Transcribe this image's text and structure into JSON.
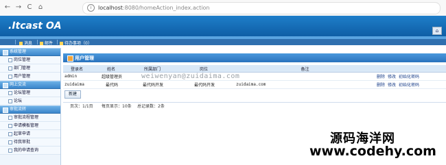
{
  "browser": {
    "back": "←",
    "forward": "→",
    "reload": "C",
    "home": "⌂",
    "info": "i",
    "url_host": "localhost",
    "url_rest": ":8080/homeAction_index.action"
  },
  "header": {
    "logo": ".Itcast OA",
    "home_icon": "⌂"
  },
  "topmenu": {
    "messages": "消息",
    "mail": "邮件",
    "todo": "待办事项（0）"
  },
  "sidebar": {
    "groups": [
      {
        "label": "系统管理",
        "items": [
          "岗位管理",
          "部门管理",
          "用户管理"
        ]
      },
      {
        "label": "网上交流",
        "items": [
          "论坛管理",
          "论坛"
        ]
      },
      {
        "label": "审批流转",
        "items": [
          "审批流程管理",
          "申请模板管理",
          "起草申请",
          "待我审批",
          "我的申请查询"
        ]
      }
    ]
  },
  "main": {
    "title": "用户管理",
    "columns": [
      "登录名",
      "姓名",
      "所属部门",
      "岗位",
      "备注",
      ""
    ],
    "rows": [
      {
        "login": "admin",
        "name": "超级管理员",
        "dept": "",
        "post": "",
        "note": "",
        "actions": [
          "删除",
          "修改",
          "初始化密码"
        ]
      },
      {
        "login": "zuidaima",
        "name": "最代码",
        "dept": "最代码开发",
        "post": "最代码开发",
        "note": "zuidaima.com",
        "actions": [
          "删除",
          "修改",
          "初始化密码"
        ]
      }
    ],
    "new_button": "新建",
    "pager": {
      "page": "页次：1/1页",
      "per_page": "每页显示：10条",
      "total": "总记录数：2条"
    }
  },
  "watermarks": {
    "center": "weiwenyan@zuidaima.com",
    "corner_line1": "源码海洋网",
    "corner_line2": "www.codehy.com"
  },
  "colors": {
    "header": "#1e7ec9",
    "menu": "#2f6fae",
    "sidebar_bg": "#eef5fc",
    "title_bar": "#2a73bd"
  }
}
